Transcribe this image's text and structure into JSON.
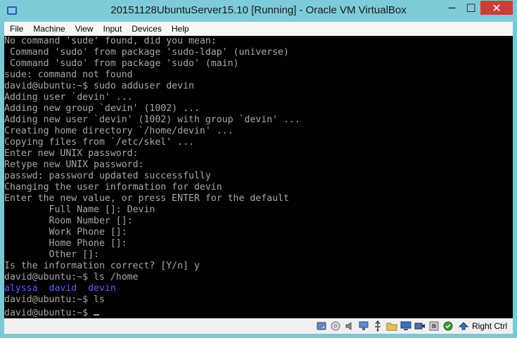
{
  "window": {
    "title": "20151128UbuntuServer15.10 [Running] - Oracle VM VirtualBox",
    "controls": {
      "minimize": "─",
      "maximize": "☐",
      "close": "✕"
    }
  },
  "menu": [
    "File",
    "Machine",
    "View",
    "Input",
    "Devices",
    "Help"
  ],
  "terminal": {
    "lines": [
      {
        "text": "No command 'sude' found, did you mean:",
        "color": "normal"
      },
      {
        "text": " Command 'sudo' from package 'sudo-ldap' (universe)",
        "color": "normal"
      },
      {
        "text": " Command 'sudo' from package 'sudo' (main)",
        "color": "normal"
      },
      {
        "text": "sude: command not found",
        "color": "normal"
      },
      {
        "text": "david@ubuntu:~$ sudo adduser devin",
        "color": "normal"
      },
      {
        "text": "Adding user `devin' ...",
        "color": "normal"
      },
      {
        "text": "Adding new group `devin' (1002) ...",
        "color": "normal"
      },
      {
        "text": "Adding new user `devin' (1002) with group `devin' ...",
        "color": "normal"
      },
      {
        "text": "Creating home directory `/home/devin' ...",
        "color": "normal"
      },
      {
        "text": "Copying files from `/etc/skel' ...",
        "color": "normal"
      },
      {
        "text": "Enter new UNIX password:",
        "color": "normal"
      },
      {
        "text": "Retype new UNIX password:",
        "color": "normal"
      },
      {
        "text": "passwd: password updated successfully",
        "color": "normal"
      },
      {
        "text": "Changing the user information for devin",
        "color": "normal"
      },
      {
        "text": "Enter the new value, or press ENTER for the default",
        "color": "normal"
      },
      {
        "text": "        Full Name []: Devin",
        "color": "normal"
      },
      {
        "text": "        Room Number []:",
        "color": "normal"
      },
      {
        "text": "        Work Phone []:",
        "color": "normal"
      },
      {
        "text": "        Home Phone []:",
        "color": "normal"
      },
      {
        "text": "        Other []:",
        "color": "normal"
      },
      {
        "text": "Is the information correct? [Y/n] y",
        "color": "normal"
      },
      {
        "text": "david@ubuntu:~$ ls /home",
        "color": "normal"
      },
      {
        "text": "alyssa  david  devin",
        "color": "blue"
      },
      {
        "text": "david@ubuntu:~$ ls",
        "color": "normal"
      },
      {
        "text": "david@ubuntu:~$ ",
        "color": "normal",
        "cursor": true
      }
    ],
    "colors": {
      "background": "#000000",
      "normal": "#a8a8a8",
      "blue": "#5c5cff"
    }
  },
  "statusbar": {
    "icons": [
      "hard-disk-icon",
      "optical-disk-icon",
      "audio-icon",
      "network-icon",
      "usb-icon",
      "shared-folder-icon",
      "display-icon",
      "video-capture-icon",
      "virtualization-icon",
      "mouse-integration-icon",
      "host-key-icon"
    ],
    "host_key_label": "Right Ctrl"
  }
}
